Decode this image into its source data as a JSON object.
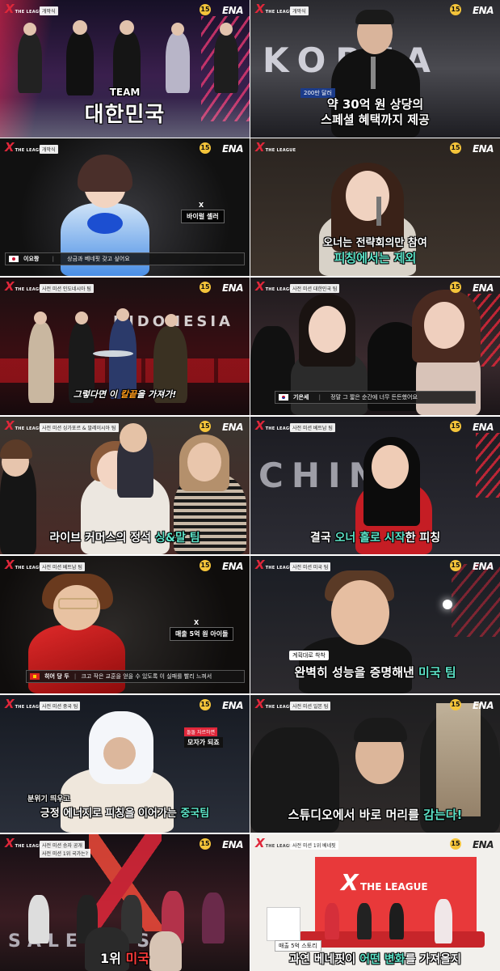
{
  "frames": [
    {
      "segment": "개막식",
      "rating": "15",
      "brand": "ENA",
      "caption_line1": "TEAM",
      "caption_line2": "대한민국"
    },
    {
      "segment": "개막식",
      "rating": "15",
      "brand": "ENA",
      "backdrop_text": "KOREA",
      "small_label": "200만 달러",
      "caption_line1": "약 30억 원 상당의",
      "caption_line2": "스페셜 혜택까지 제공"
    },
    {
      "segment": "개막식",
      "rating": "15",
      "brand": "ENA",
      "tag_icon": "X",
      "tag_label": "바이럴 셀러",
      "name": "이요짱",
      "quote": "상금과 베네핏 갖고 싶어요",
      "flag_colors": [
        "#ffffff",
        "#c8102e"
      ]
    },
    {
      "segment": "",
      "rating": "15",
      "brand": "ENA",
      "caption_line1": "오너는 전략회의만 참여",
      "caption_line2": "피칭에서는 제외"
    },
    {
      "segment": "사전 미션 인도네시아 팀",
      "rating": "15",
      "brand": "ENA",
      "backdrop_text": "INDONESIA",
      "caption_pre": "그렇다면 이 ",
      "caption_highlight": "칼끝",
      "caption_post": "을 가져가!"
    },
    {
      "segment": "사전 미션 대한민국 팀",
      "rating": "15",
      "brand": "ENA",
      "name": "기은세",
      "quote": "정말 그 짧은 순간에 너무 든든했어요",
      "flag_colors": [
        "#ffffff",
        "#1b2d8f"
      ]
    },
    {
      "segment": "사전 미션 싱가포르 & 말레이시아 팀",
      "rating": "15",
      "brand": "ENA",
      "caption_pre": "라이브 커머스의 정석 ",
      "caption_highlight": "싱&말 팀"
    },
    {
      "segment": "사전 미션 베트남 팀",
      "rating": "15",
      "brand": "ENA",
      "backdrop_text": "CHINA",
      "caption_pre": "결국 ",
      "caption_highlight": "오너 홀로 시작",
      "caption_post": "한 피칭"
    },
    {
      "segment": "사전 미션 베트남 팀",
      "rating": "15",
      "brand": "ENA",
      "tag_icon": "X",
      "tag_label": "매출 5억 원 아이돌",
      "name": "히어 당 두",
      "quote": "크고 작은 교훈을 얻을 수 있도록 이 실패를 빨리 느껴서",
      "flag_colors": [
        "#da251d",
        "#ffcd00"
      ]
    },
    {
      "segment": "사전 미션 미국 팀",
      "rating": "15",
      "brand": "ENA",
      "small_label": "계획대로 착착",
      "caption_pre": "완벽히 성능을 증명해낸 ",
      "caption_highlight": "미국 팀"
    },
    {
      "segment": "사전 미션 중국 팀",
      "rating": "15",
      "brand": "ENA",
      "side_label_top": "돌돌 자르하면",
      "side_label": "모자가 되죠",
      "caption_small": "분위기 띄우고",
      "caption_pre": "긍정 에너지로 피칭을 이어가는 ",
      "caption_highlight": "중국팀"
    },
    {
      "segment": "사전 미션 일본 팀",
      "rating": "15",
      "brand": "ENA",
      "caption_pre": "스튜디오에서 바로 머리를 ",
      "caption_highlight": "감는다!"
    },
    {
      "segment": "사전 미션 승자 공개",
      "segment2": "사전 미션 1위 국가는?",
      "rating": "15",
      "brand": "ENA",
      "backdrop_text": "SALES US",
      "caption_pre": "1위 ",
      "caption_highlight": "미국"
    },
    {
      "segment": "사전 미션 1위 베네핏",
      "rating": "15",
      "brand": "ENA",
      "wall_logo": "THE LEAGUE",
      "small_label": "매출 5억 스토리",
      "caption_pre": "과연 베네핏이 ",
      "caption_highlight": "어떤 변화",
      "caption_post": "를 가져올지"
    }
  ],
  "logo": {
    "mark": "X",
    "sub": "THE LEAGUE"
  },
  "colors": {
    "accent": "#e0273a",
    "caption_highlight": "#5de3c8",
    "rating_badge": "#f4c43a"
  }
}
